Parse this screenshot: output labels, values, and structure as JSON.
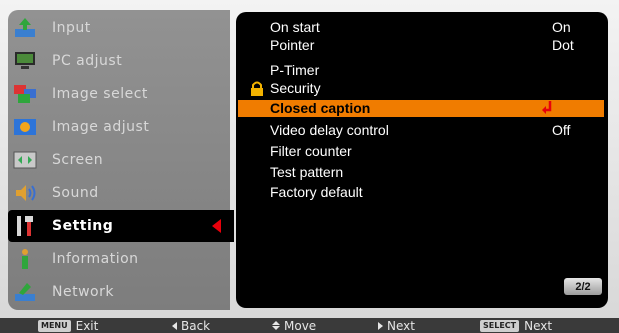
{
  "left_menu": [
    {
      "label": "Input",
      "icon": "input-icon"
    },
    {
      "label": "PC adjust",
      "icon": "pc-adjust-icon"
    },
    {
      "label": "Image select",
      "icon": "image-select-icon"
    },
    {
      "label": "Image adjust",
      "icon": "image-adjust-icon"
    },
    {
      "label": "Screen",
      "icon": "screen-icon"
    },
    {
      "label": "Sound",
      "icon": "sound-icon"
    },
    {
      "label": "Setting",
      "icon": "setting-icon",
      "selected": true
    },
    {
      "label": "Information",
      "icon": "information-icon"
    },
    {
      "label": "Network",
      "icon": "network-icon"
    }
  ],
  "settings": [
    {
      "name": "On start",
      "value": "On"
    },
    {
      "name": "Pointer",
      "value": "Dot"
    },
    {
      "name": "P-Timer",
      "value": ""
    },
    {
      "name": "Security",
      "value": "",
      "icon": "lock-icon"
    },
    {
      "name": "Closed caption",
      "value": "",
      "selected": true
    },
    {
      "name": "Video delay control",
      "value": "Off"
    },
    {
      "name": "Filter counter",
      "value": ""
    },
    {
      "name": "Test pattern",
      "value": ""
    },
    {
      "name": "Factory default",
      "value": ""
    }
  ],
  "page_indicator": "2/2",
  "guide": {
    "exit_key": "MENU",
    "exit_label": "Exit",
    "back_label": "Back",
    "move_label": "Move",
    "next_label": "Next",
    "select_key": "SELECT",
    "select_next_label": "Next"
  },
  "colors": {
    "highlight": "#f07c00",
    "accent_red": "#e8000b",
    "panel_bg": "#000000"
  }
}
